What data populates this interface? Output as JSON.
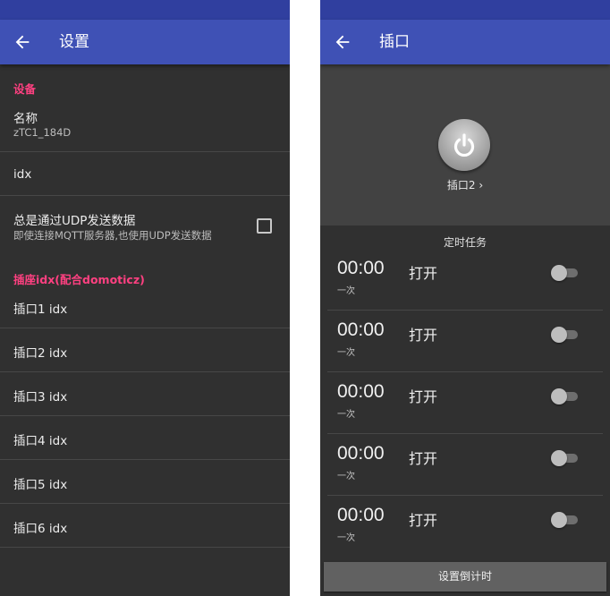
{
  "settings": {
    "title": "设置",
    "section_device": "设备",
    "name_label": "名称",
    "name_value": "zTC1_184D",
    "idx_label": "idx",
    "udp_label": "总是通过UDP发送数据",
    "udp_desc": "即使连接MQTT服务器,也使用UDP发送数据",
    "udp_checked": false,
    "section_socket_idx": "插座idx(配合domoticz)",
    "socket_idx_items": [
      "插口1 idx",
      "插口2 idx",
      "插口3 idx",
      "插口4 idx",
      "插口5 idx",
      "插口6 idx"
    ]
  },
  "socket": {
    "title": "插口",
    "plug_name": "插口2",
    "timer_title": "定时任务",
    "tasks": [
      {
        "time": "00:00",
        "repeat": "一次",
        "action": "打开",
        "enabled": false
      },
      {
        "time": "00:00",
        "repeat": "一次",
        "action": "打开",
        "enabled": false
      },
      {
        "time": "00:00",
        "repeat": "一次",
        "action": "打开",
        "enabled": false
      },
      {
        "time": "00:00",
        "repeat": "一次",
        "action": "打开",
        "enabled": false
      },
      {
        "time": "00:00",
        "repeat": "一次",
        "action": "打开",
        "enabled": false
      }
    ],
    "countdown_button": "设置倒计时"
  },
  "colors": {
    "primary": "#3F51B5",
    "primary_dark": "#303F9F",
    "accent": "#FF4081",
    "background": "#303030"
  }
}
